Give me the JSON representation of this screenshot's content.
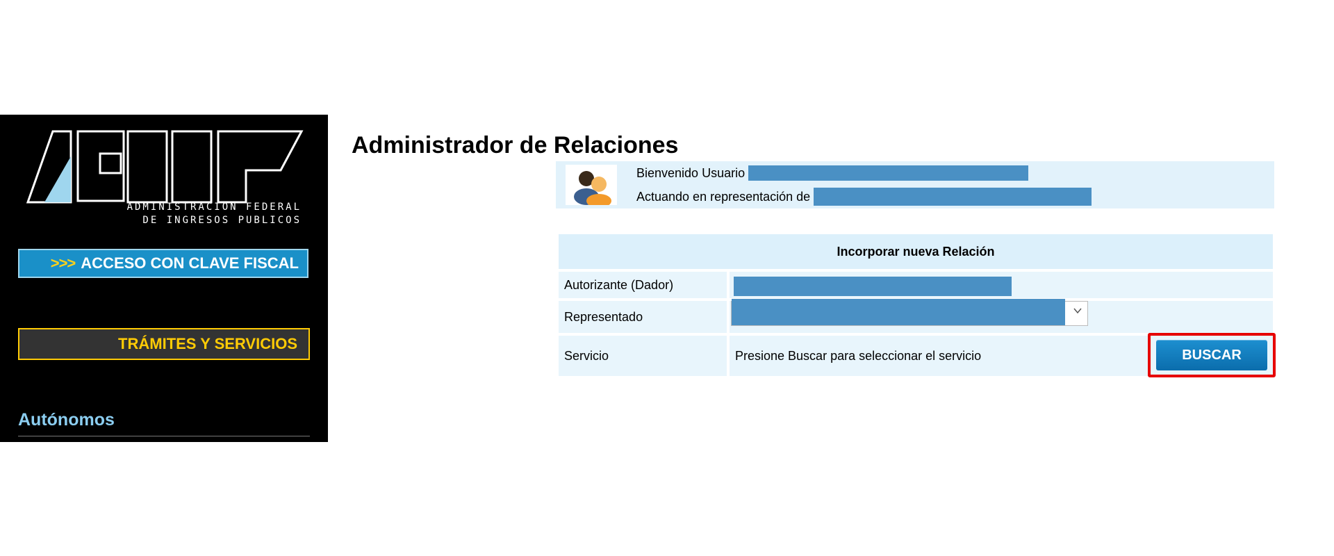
{
  "sidebar": {
    "logo_text": "AFIP",
    "logo_subtitle": "ADMINISTRACION FEDERAL\nDE INGRESOS PUBLICOS",
    "clave_fiscal_chevrons": ">>>",
    "clave_fiscal_label": "ACCESO CON CLAVE FISCAL",
    "tramites_label": "TRÁMITES Y SERVICIOS",
    "autonomos_label": "Autónomos"
  },
  "page": {
    "title": "Administrador de Relaciones"
  },
  "welcome": {
    "user_prefix": "Bienvenido Usuario",
    "representation_prefix": "Actuando en representación de"
  },
  "form": {
    "header": "Incorporar nueva Relación",
    "autorizante_label": "Autorizante (Dador)",
    "representado_label": "Representado",
    "servicio_label": "Servicio",
    "servicio_placeholder": "Presione Buscar para seleccionar el servicio",
    "buscar_label": "BUSCAR"
  },
  "colors": {
    "sidebar_bg": "#000000",
    "clave_fiscal_bg": "#1a90c8",
    "tramites_accent": "#ffcb05",
    "form_bg": "#e8f5fc",
    "button_blue": "#0b6dac",
    "highlight_red": "#e60000",
    "redaction": "#4a90c4"
  }
}
